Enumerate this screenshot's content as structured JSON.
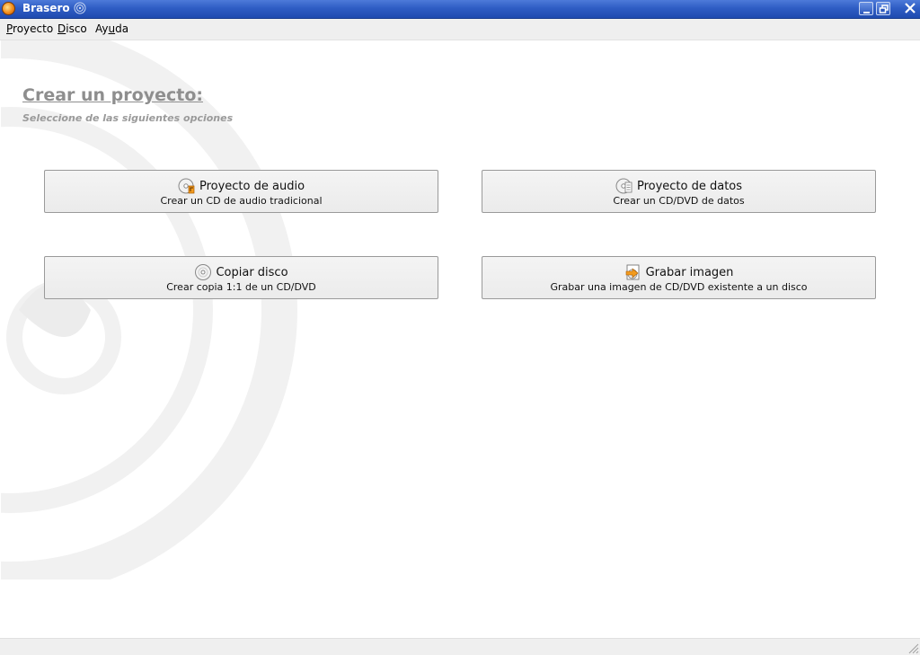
{
  "window": {
    "title": "Brasero",
    "app_icon": "brasero-flame-icon",
    "controls": [
      "minimize-icon",
      "restore-icon",
      "close-icon"
    ]
  },
  "menubar": {
    "items": [
      {
        "label": "Proyecto",
        "mnemonic": "P"
      },
      {
        "label": "Disco",
        "mnemonic": "D"
      },
      {
        "label": "Ayuda",
        "mnemonic": "u"
      }
    ]
  },
  "main": {
    "heading": "Crear un proyecto:",
    "subheading": "Seleccione de las siguientes opciones",
    "options": [
      {
        "title": "Proyecto de audio",
        "description": "Crear un CD de audio tradicional",
        "icon": "audio-disc-icon"
      },
      {
        "title": "Proyecto de datos",
        "description": "Crear un CD/DVD de datos",
        "icon": "data-disc-icon"
      },
      {
        "title": "Copiar disco",
        "description": "Crear copia 1:1 de un CD/DVD",
        "icon": "copy-disc-icon"
      },
      {
        "title": "Grabar imagen",
        "description": "Grabar una imagen de CD/DVD existente a un disco",
        "icon": "burn-image-icon"
      }
    ]
  },
  "colors": {
    "titlebar": "#2f5dc4",
    "heading": "#8e8e8e",
    "button_border": "#9a9a9a"
  }
}
